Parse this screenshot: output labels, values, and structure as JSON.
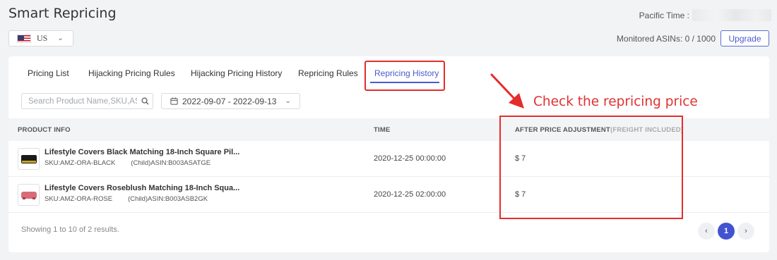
{
  "header": {
    "title": "Smart Repricing",
    "market": "US",
    "pacific_time_label": "Pacific Time :",
    "monitored_label": "Monitored ASINs: 0 / 1000",
    "upgrade_label": "Upgrade"
  },
  "tabs": [
    {
      "label": "Pricing List"
    },
    {
      "label": "Hijacking Pricing Rules"
    },
    {
      "label": "Hijacking Pricing History"
    },
    {
      "label": "Repricing Rules"
    },
    {
      "label": "Repricing History",
      "active": true
    }
  ],
  "filters": {
    "search_placeholder": "Search Product Name,SKU,ASIN",
    "date_range": "2022-09-07 - 2022-09-13"
  },
  "table": {
    "columns": {
      "product": "PRODUCT INFO",
      "time": "TIME",
      "after_price": "AFTER PRICE ADJUSTMENT",
      "after_price_note": "(FREIGHT INCLUDED)"
    },
    "rows": [
      {
        "name": "Lifestyle Covers Black Matching 18-Inch Square Pil...",
        "sku": "SKU:AMZ-ORA-BLACK",
        "asin": "(Child)ASIN:B003ASATGE",
        "time": "2020-12-25 00:00:00",
        "price": "$ 7",
        "thumb_icon": "black-pillow-product-icon",
        "thumb_color": "#1a1a1a"
      },
      {
        "name": "Lifestyle Covers Roseblush Matching 18-Inch Squa...",
        "sku": "SKU:AMZ-ORA-ROSE",
        "asin": "(Child)ASIN:B003ASB2GK",
        "time": "2020-12-25 02:00:00",
        "price": "$ 7",
        "thumb_icon": "rose-pillow-product-icon",
        "thumb_color": "#d96b78"
      }
    ]
  },
  "footer": {
    "summary": "Showing 1 to 10 of 2 results.",
    "current_page": "1"
  },
  "annotation": {
    "callout": "Check the repricing price",
    "color": "#e52c2c"
  },
  "colors": {
    "accent": "#4a5bcf",
    "highlight": "#e52c2c"
  }
}
